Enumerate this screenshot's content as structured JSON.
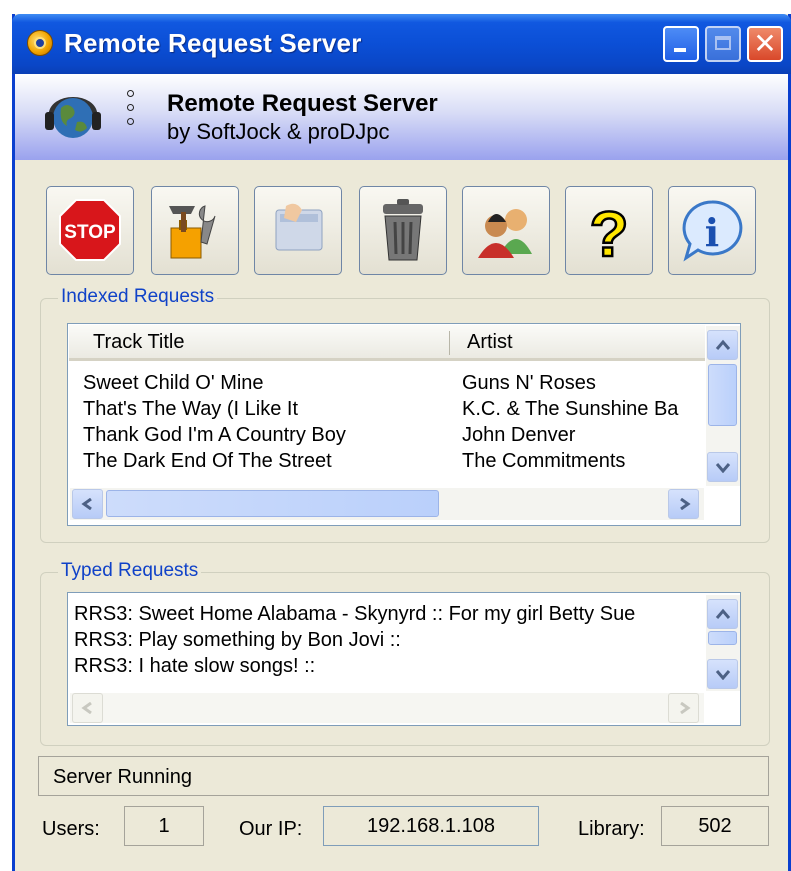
{
  "window": {
    "title": "Remote Request Server"
  },
  "header": {
    "title": "Remote Request Server",
    "subtitle": "by SoftJock & proDJpc"
  },
  "toolbar": [
    {
      "name": "stop-button",
      "icon": "stop-sign-icon",
      "text": "STOP"
    },
    {
      "name": "settings-button",
      "icon": "tools-icon"
    },
    {
      "name": "card-button",
      "icon": "card-icon"
    },
    {
      "name": "delete-button",
      "icon": "trash-can-icon"
    },
    {
      "name": "users-button",
      "icon": "users-icon"
    },
    {
      "name": "help-button",
      "icon": "question-mark-icon",
      "text": "?"
    },
    {
      "name": "info-button",
      "icon": "info-icon",
      "text": "i"
    }
  ],
  "indexed": {
    "label": "Indexed Requests",
    "columns": [
      "Track Title",
      "Artist"
    ],
    "rows": [
      [
        "Sweet Child O' Mine",
        "Guns N' Roses"
      ],
      [
        "That's The Way (I Like It",
        "K.C. & The Sunshine Ba"
      ],
      [
        "Thank God I'm A Country Boy",
        "John Denver"
      ],
      [
        "The Dark End Of The Street",
        "The Commitments"
      ]
    ]
  },
  "typed": {
    "label": "Typed Requests",
    "lines": [
      "RRS3: Sweet Home Alabama - Skynyrd :: For my girl Betty Sue",
      "RRS3: Play something by Bon Jovi ::",
      "RRS3: I hate slow songs! ::"
    ]
  },
  "status": "Server Running",
  "stats": {
    "users_label": "Users:",
    "users": "1",
    "ip_label": "Our IP:",
    "ip": "192.168.1.108",
    "library_label": "Library:",
    "library": "502"
  },
  "colors": {
    "titlebar": "#0b4fd6",
    "face": "#ece9d8",
    "group_label": "#1042c8"
  }
}
